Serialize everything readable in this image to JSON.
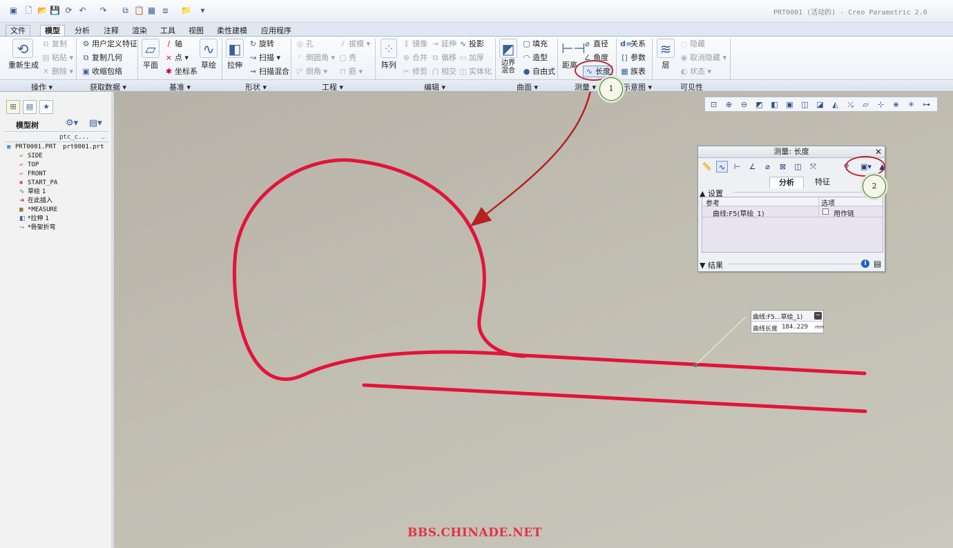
{
  "window": {
    "title": "PRT0001 (活动的) - Creo Parametric 2.0"
  },
  "quick_access": {
    "icons": [
      "new-icon",
      "open-icon",
      "save-icon",
      "regenerate-icon",
      "undo-icon",
      "redo-icon",
      "copy-icon",
      "paste-icon",
      "window-icon",
      "window-switch-icon",
      "folder-icon",
      "more-icon"
    ]
  },
  "tabs": [
    "文件",
    "模型",
    "分析",
    "注释",
    "渲染",
    "工具",
    "视图",
    "柔性建模",
    "应用程序"
  ],
  "ribbon": {
    "operations": {
      "regenerate": "重新生成",
      "copy": "复制",
      "paste": "粘贴",
      "delete": "删除"
    },
    "get_data": {
      "udf": "用户定义特征",
      "copy_geom": "复制几何",
      "shrinkwrap": "收缩包络"
    },
    "datum": {
      "plane": "平面",
      "axis": "轴",
      "point": "点",
      "csys": "坐标系",
      "sketch": "草绘"
    },
    "shapes": {
      "extrude": "拉伸",
      "revolve": "旋转",
      "sweep": "扫描",
      "swept_blend": "扫描混合"
    },
    "engineering": {
      "hole": "孔",
      "round": "倒圆角",
      "chamfer": "倒角",
      "draft": "拔模",
      "shell": "壳",
      "rib": "筋"
    },
    "editing": {
      "pattern": "阵列",
      "mirror": "镜像",
      "merge": "合并",
      "trim": "修剪",
      "extend": "延伸",
      "offset": "偏移",
      "intersect": "相交",
      "project": "投影",
      "thicken": "加厚",
      "solidify": "实体化"
    },
    "surfaces": {
      "boundary_blend": "边界混合",
      "fill": "填充",
      "style": "造型",
      "freestyle": "自由式"
    },
    "measure": {
      "distance": "距离",
      "diameter": "直径",
      "angle": "角度",
      "length": "长度"
    },
    "model_intent": {
      "relations": "关系",
      "parameters": "参数",
      "family_table": "族表"
    },
    "layers": {
      "layer": "层",
      "hide": "隐藏",
      "unhide": "取消隐藏",
      "status": "状态"
    }
  },
  "groups": [
    "操作 ▾",
    "获取数据 ▾",
    "基准 ▾",
    "形状 ▾",
    "工程 ▾",
    "编辑 ▾",
    "曲面 ▾",
    "测量 ▾",
    "示意图 ▾",
    "可见性"
  ],
  "model_tree": {
    "title": "模型树",
    "columns": [
      "",
      "ptc_c..."
    ],
    "items": [
      {
        "label": "PRT0001.PRT",
        "extra": "prt0001.prt",
        "icon": "part-icon"
      },
      {
        "label": "SIDE",
        "icon": "datum-plane-icon"
      },
      {
        "label": "TOP",
        "icon": "datum-plane-icon"
      },
      {
        "label": "FRONT",
        "icon": "datum-plane-icon"
      },
      {
        "label": "START_PA",
        "icon": "csys-icon"
      },
      {
        "label": "草绘 1",
        "icon": "sketch-icon"
      },
      {
        "label": "在此插入",
        "icon": "insert-arrow-icon"
      },
      {
        "label": "*MEASURE",
        "icon": "measure-icon"
      },
      {
        "label": "*拉伸 1",
        "icon": "extrude-icon"
      },
      {
        "label": "*骨架折弯",
        "icon": "bend-icon"
      }
    ]
  },
  "measure_dialog": {
    "title": "测量: 长度",
    "tabs": [
      "分析",
      "特征"
    ],
    "settings_label": "设置",
    "table_headers": [
      "参考",
      "选项"
    ],
    "reference": "曲线:F5(草绘_1)",
    "option_label": "用作链",
    "results_label": "结果"
  },
  "callout": {
    "title": "曲线:F5...草绘_1)",
    "length_label": "曲线长度",
    "length_value": "184.229",
    "unit": "mm"
  },
  "badges": [
    "1",
    "2"
  ],
  "watermark": "BBS.CHINADE.NET",
  "colors": {
    "curve": "#e3133a",
    "annotation_arrow": "#b52222",
    "badge_border": "#2f7a3a"
  }
}
